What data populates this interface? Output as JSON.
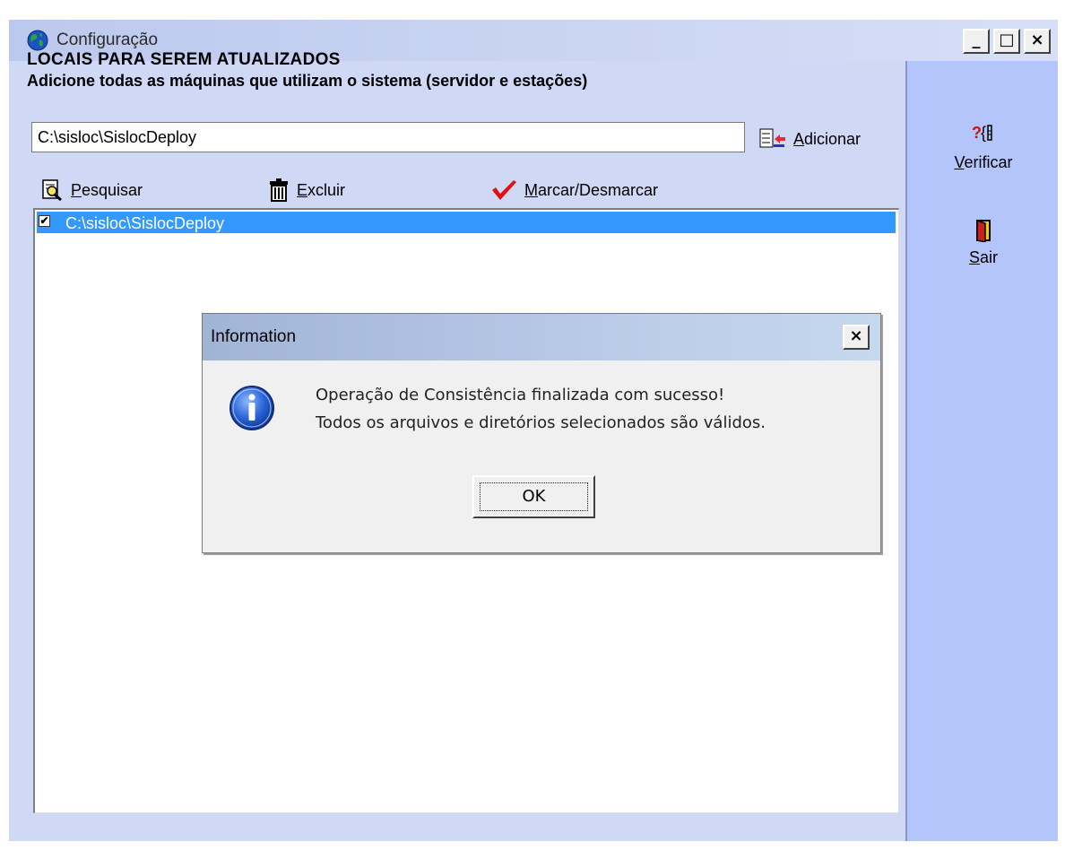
{
  "window": {
    "title": "Configuração",
    "controls": {
      "minimize": "_",
      "maximize": "□",
      "close": "×"
    }
  },
  "header": {
    "heading": "LOCAIS PARA SEREM ATUALIZADOS",
    "subheading": "Adicione todas as máquinas que utilizam o sistema (servidor e estações)"
  },
  "path_input": {
    "value": "C:\\sisloc\\SislocDeploy"
  },
  "add_button": {
    "label_accel": "A",
    "label_rest": "dicionar"
  },
  "toolbar": {
    "search": {
      "accel": "P",
      "rest": "esquisar"
    },
    "delete": {
      "accel": "E",
      "rest": "xcluir"
    },
    "toggle": {
      "accel": "M",
      "rest": "arcar/Desmarcar"
    }
  },
  "list": {
    "items": [
      {
        "label": "C:\\sisloc\\SislocDeploy",
        "checked": true,
        "check_glyph": "✔"
      }
    ]
  },
  "side": {
    "verify": {
      "accel": "V",
      "rest": "erificar"
    },
    "exit": {
      "accel": "S",
      "rest": "air"
    }
  },
  "dialog": {
    "title": "Information",
    "close": "×",
    "message_line1": "Operação de Consistência finalizada com sucesso!",
    "message_line2": "Todos os arquivos e diretórios selecionados são válidos.",
    "ok_label": "OK"
  },
  "colors": {
    "panel": "#cfd8f4",
    "side_panel": "#b4c5fb",
    "selection": "#3399ff",
    "check_red": "#e01010"
  }
}
